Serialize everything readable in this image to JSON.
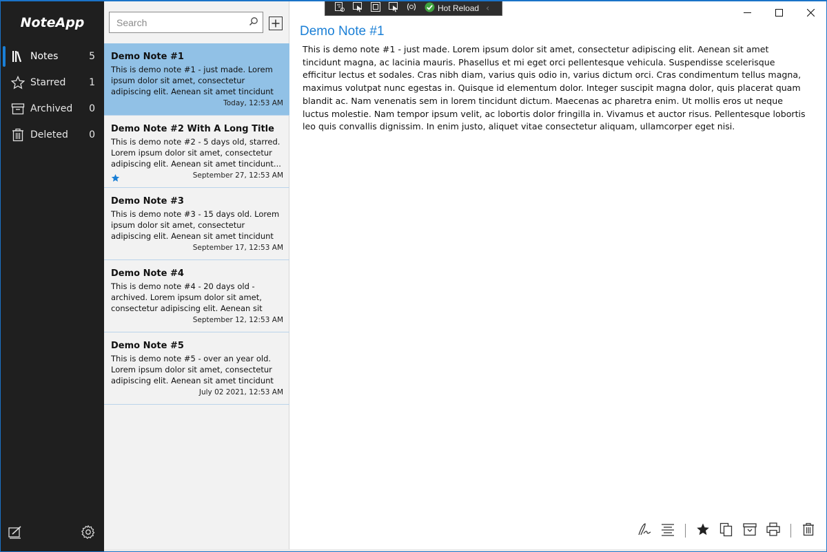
{
  "app": {
    "title": "NoteApp"
  },
  "sidebar": {
    "items": [
      {
        "label": "Notes",
        "count": "5",
        "icon": "books-icon",
        "active": true
      },
      {
        "label": "Starred",
        "count": "1",
        "icon": "star-outline-icon",
        "active": false
      },
      {
        "label": "Archived",
        "count": "0",
        "icon": "archive-icon",
        "active": false
      },
      {
        "label": "Deleted",
        "count": "0",
        "icon": "trash-icon",
        "active": false
      }
    ],
    "footer": {
      "new_note_icon": "new-note-icon",
      "settings_icon": "gear-icon"
    }
  },
  "search": {
    "placeholder": "Search",
    "value": ""
  },
  "notes": [
    {
      "title": "Demo Note #1",
      "preview": "This is demo note #1 - just made. Lorem ipsum dolor sit amet, consectetur adipiscing elit. Aenean sit amet tincidunt magna, ac lacinia...",
      "date": "Today, 12:53 AM",
      "selected": true,
      "starred": false
    },
    {
      "title": "Demo Note #2 With A Long Title",
      "preview": "This is demo note #2 - 5 days old, starred. Lorem ipsum dolor sit amet, consectetur adipiscing elit. Aenean sit amet tincidunt...",
      "date": "September 27, 12:53 AM",
      "selected": false,
      "starred": true
    },
    {
      "title": "Demo Note #3",
      "preview": "This is demo note #3 - 15 days old. Lorem ipsum dolor sit amet, consectetur adipiscing elit. Aenean sit amet tincidunt magna, ac...",
      "date": "September 17, 12:53 AM",
      "selected": false,
      "starred": false
    },
    {
      "title": "Demo Note #4",
      "preview": "This is demo note #4 - 20 days old - archived. Lorem ipsum dolor sit amet, consectetur adipiscing elit. Aenean sit amet tincidunt...",
      "date": "September 12, 12:53 AM",
      "selected": false,
      "starred": false
    },
    {
      "title": "Demo Note #5",
      "preview": "This is demo note #5 - over an year old. Lorem ipsum dolor sit amet, consectetur adipiscing elit. Aenean sit amet tincidunt magna, ac...",
      "date": "July 02 2021, 12:53 AM",
      "selected": false,
      "starred": false
    }
  ],
  "editor": {
    "title": "Demo Note #1",
    "body": "This is demo note #1 - just made. Lorem ipsum dolor sit amet, consectetur adipiscing elit. Aenean sit amet tincidunt magna, ac lacinia mauris. Phasellus et mi eget orci pellentesque vehicula. Suspendisse scelerisque efficitur lectus et sodales. Cras nibh diam, varius quis odio in, varius dictum orci. Cras condimentum tellus magna, maximus volutpat nunc egestas in. Quisque id elementum dolor. Integer suscipit magna dolor, quis placerat quam blandit ac. Nam venenatis sem in lorem tincidunt dictum. Maecenas ac pharetra enim. Ut mollis eros ut neque luctus molestie. Nam tempor ipsum velit, ac lobortis dolor fringilla in. Vivamus et auctor risus. Pellentesque lobortis leo quis convallis dignissim. In enim justo, aliquet vitae consectetur aliquam, ullamcorper eget nisi."
  },
  "debug_toolbar": {
    "hot_reload_label": "Hot Reload"
  },
  "colors": {
    "accent": "#1a7fd6",
    "selected_note": "#91c1e6",
    "sidebar_bg": "#1f1f1f",
    "list_bg": "#f2f2f2"
  }
}
